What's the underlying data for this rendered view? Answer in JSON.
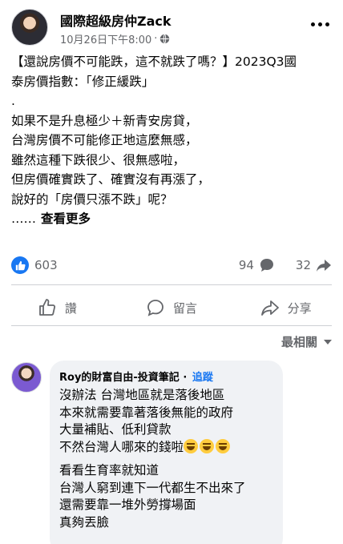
{
  "post": {
    "author": "國際超級房仲Zack",
    "timestamp": "10月26日下午8:00",
    "separator": "·",
    "privacy_icon": "globe-icon",
    "body_lines": [
      "【還說房價不可能跌，這不就跌了嗎？】2023Q3國",
      "泰房價指數：「修正緩跌」",
      ".",
      "如果不是升息極少＋新青安房貸，",
      "台灣房價不可能修正地這麼無感，",
      "雖然這種下跌很少、很無感啦，",
      "但房價確實跌了、確實沒有再漲了，",
      "說好的「房價只漲不跌」呢？"
    ],
    "ellipsis": "……",
    "see_more": "查看更多"
  },
  "stats": {
    "likes": "603",
    "comments": "94",
    "shares": "32"
  },
  "actions": {
    "like": "讚",
    "comment": "留言",
    "share": "分享"
  },
  "sort": {
    "label": "最相關"
  },
  "comment": {
    "author": "Roy的財富自由-投資筆記",
    "separator": "·",
    "follow": "追蹤",
    "lines": [
      "沒辦法 台灣地區就是落後地區",
      "本來就需要靠著落後無能的政府",
      "大量補貼、低利貸款",
      "不然台灣人哪來的錢啦"
    ],
    "emoji_count": 3,
    "lines2": [
      "看看生育率就知道",
      "台灣人窮到連下一代都生不出來了",
      "還需要靠一堆外勞撐場面",
      "真夠丟臉"
    ]
  },
  "colors": {
    "accent": "#1877f2",
    "muted": "#65676b",
    "bubble": "#f0f2f5"
  }
}
